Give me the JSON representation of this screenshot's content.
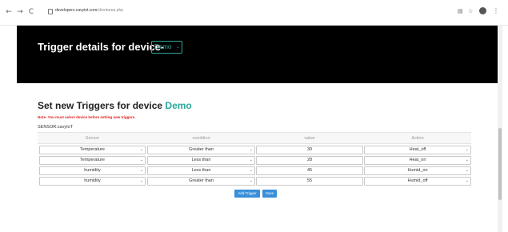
{
  "browser": {
    "back_icon": "←",
    "forward_icon": "→",
    "reload_icon": "C",
    "url_host": "developers.cavyiot.com",
    "url_path": "/clientarea.php"
  },
  "header": {
    "title": "Trigger details for device-",
    "device_value": "Demo"
  },
  "main": {
    "title_prefix": "Set new Triggers for device",
    "title_device": "Demo",
    "note": "Note- You must select device before setting new triggers.",
    "sensor_label": "SENSOR:cavyIoT"
  },
  "table": {
    "headers": [
      "Sensor",
      "condition",
      "value",
      "Action"
    ],
    "rows": [
      {
        "sensor": "Temperature",
        "condition": "Greater than",
        "value": "30",
        "action": "Heat_off"
      },
      {
        "sensor": "Temperature",
        "condition": "Less than",
        "value": "28",
        "action": "Heat_on"
      },
      {
        "sensor": "humidity",
        "condition": "Less than",
        "value": "45",
        "action": "Humid_on"
      },
      {
        "sensor": "humidity",
        "condition": "Greater than",
        "value": "55",
        "action": "Humid_off"
      }
    ]
  },
  "buttons": {
    "add_trigger": "Add Trigger",
    "save": "Save"
  },
  "colors": {
    "accent": "#2aa79b",
    "note": "#e0201b",
    "button": "#3a8fd9"
  }
}
